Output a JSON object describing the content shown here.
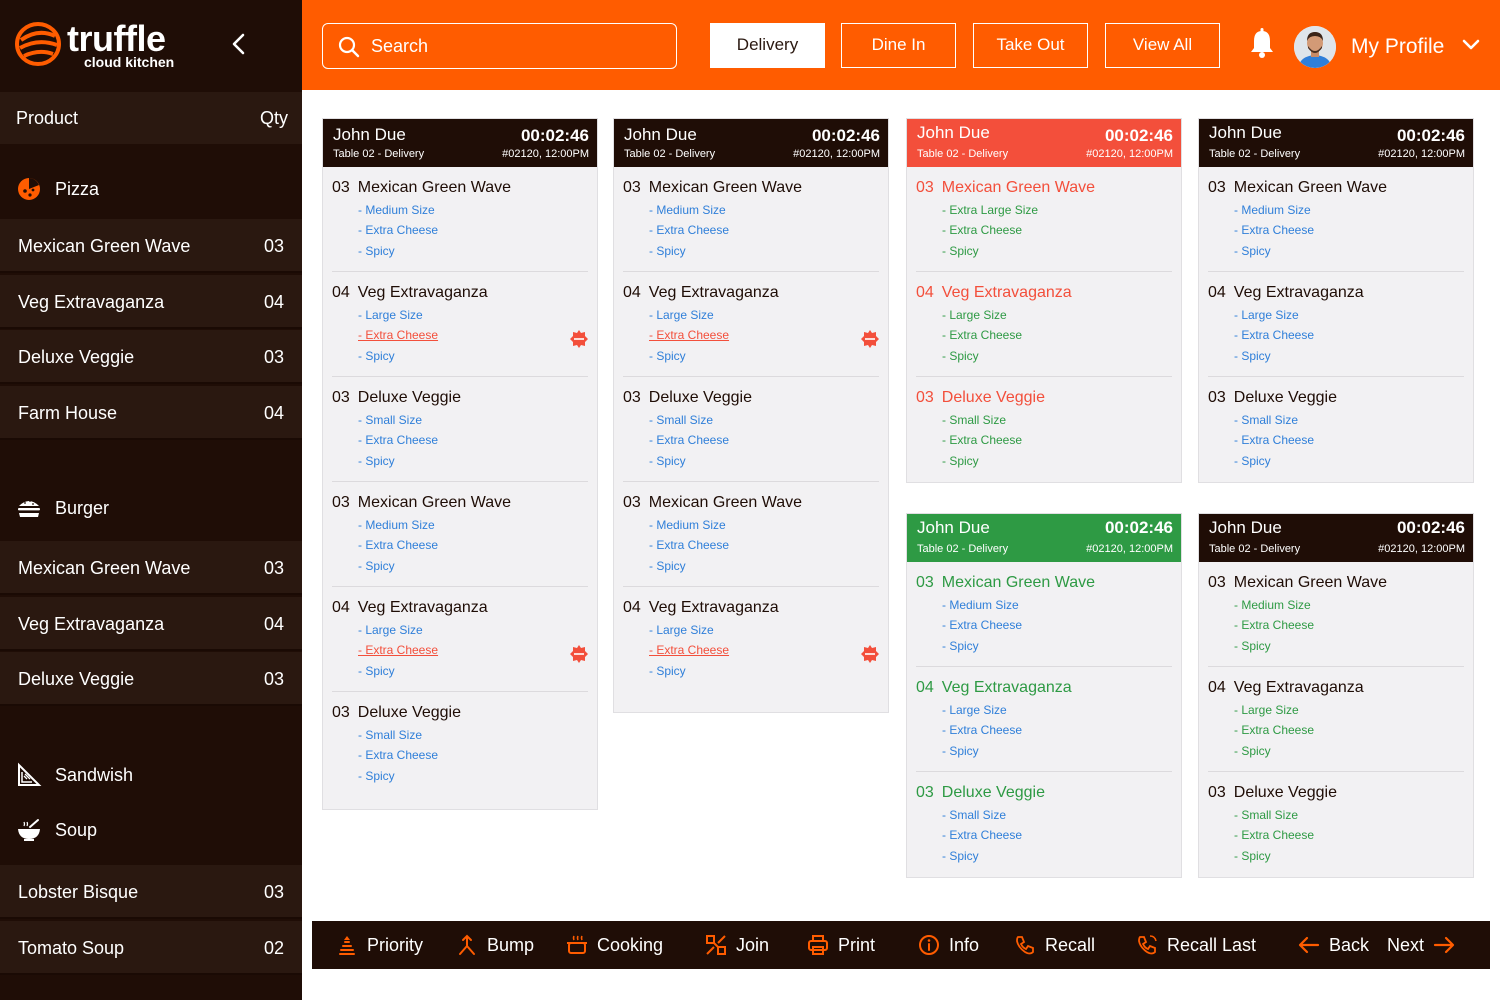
{
  "brand": {
    "name": "truffle",
    "tagline": "cloud kitchen"
  },
  "sidebar": {
    "header": {
      "product": "Product",
      "qty": "Qty"
    },
    "categories": [
      {
        "label": "Pizza",
        "icon": "pizza-icon",
        "items": [
          {
            "name": "Mexican Green Wave",
            "qty": "03"
          },
          {
            "name": "Veg Extravaganza",
            "qty": "04"
          },
          {
            "name": "Deluxe Veggie",
            "qty": "03"
          },
          {
            "name": "Farm House",
            "qty": "04"
          }
        ]
      },
      {
        "label": "Burger",
        "icon": "burger-icon",
        "items": [
          {
            "name": "Mexican Green Wave",
            "qty": "03"
          },
          {
            "name": "Veg Extravaganza",
            "qty": "04"
          },
          {
            "name": "Deluxe Veggie",
            "qty": "03"
          }
        ]
      },
      {
        "label": "Sandwish",
        "icon": "sandwich-icon",
        "items": []
      },
      {
        "label": "Soup",
        "icon": "soup-icon",
        "items": [
          {
            "name": "Lobster Bisque",
            "qty": "03"
          },
          {
            "name": "Tomato Soup",
            "qty": "02"
          }
        ]
      }
    ]
  },
  "header": {
    "search_placeholder": "Search",
    "filters": [
      "Delivery",
      "Dine In",
      "Take Out",
      "View All"
    ],
    "active_filter": "Delivery",
    "profile_name": "My Profile"
  },
  "colors": {
    "accent": "#ff5c00",
    "dark": "#1f0d06",
    "alert": "#f34f3b",
    "ready": "#2e9a44",
    "link": "#2f7fd9"
  },
  "orders": [
    {
      "customer": "John Due",
      "timer": "00:02:46",
      "table": "Table 02 - Delivery",
      "meta": "#02120,  12:00PM",
      "status": "default",
      "items": [
        {
          "qty": "03",
          "name": "Mexican Green Wave",
          "mods": [
            "- Medium Size",
            "- Extra Cheese",
            "- Spicy"
          ]
        },
        {
          "qty": "04",
          "name": "Veg Extravaganza",
          "mods": [
            "- Large Size",
            "- Extra Cheese",
            "- Spicy"
          ],
          "new": true
        },
        {
          "qty": "03",
          "name": "Deluxe Veggie",
          "mods": [
            "- Small Size",
            "- Extra Cheese",
            "- Spicy"
          ]
        },
        {
          "qty": "03",
          "name": "Mexican Green Wave",
          "mods": [
            "- Medium Size",
            "- Extra Cheese",
            "- Spicy"
          ]
        },
        {
          "qty": "04",
          "name": "Veg Extravaganza",
          "mods": [
            "- Large Size",
            "- Extra Cheese",
            "- Spicy"
          ],
          "new": true
        },
        {
          "qty": "03",
          "name": "Deluxe Veggie",
          "mods": [
            "- Small Size",
            "- Extra Cheese",
            "- Spicy"
          ]
        }
      ]
    },
    {
      "customer": "John Due",
      "timer": "00:02:46",
      "table": "Table 02 - Delivery",
      "meta": "#02120,  12:00PM",
      "status": "default",
      "items": [
        {
          "qty": "03",
          "name": "Mexican Green Wave",
          "mods": [
            "- Medium Size",
            "- Extra Cheese",
            "- Spicy"
          ]
        },
        {
          "qty": "04",
          "name": "Veg Extravaganza",
          "mods": [
            "- Large Size",
            "- Extra Cheese",
            "- Spicy"
          ],
          "new": true
        },
        {
          "qty": "03",
          "name": "Deluxe Veggie",
          "mods": [
            "- Small Size",
            "- Extra Cheese",
            "- Spicy"
          ]
        },
        {
          "qty": "03",
          "name": "Mexican Green Wave",
          "mods": [
            "- Medium Size",
            "- Extra Cheese",
            "- Spicy"
          ]
        },
        {
          "qty": "04",
          "name": "Veg Extravaganza",
          "mods": [
            "- Large Size",
            "- Extra Cheese",
            "- Spicy"
          ],
          "new": true
        }
      ]
    },
    {
      "customer": "John Due",
      "timer": "00:02:46",
      "table": "Table 02 - Delivery",
      "meta": "#02120,  12:00PM",
      "status": "overdue",
      "items": [
        {
          "qty": "03",
          "name": "Mexican Green Wave",
          "mods": [
            "- Extra Large Size",
            "- Extra Cheese",
            "- Spicy"
          ]
        },
        {
          "qty": "04",
          "name": "Veg Extravaganza",
          "mods": [
            "- Large Size",
            "- Extra Cheese",
            "- Spicy"
          ]
        },
        {
          "qty": "03",
          "name": "Deluxe Veggie",
          "mods": [
            "- Small Size",
            "- Extra Cheese",
            "- Spicy"
          ]
        }
      ]
    },
    {
      "customer": "John Due",
      "timer": "00:02:46",
      "table": "Table 02 - Delivery",
      "meta": "#02120,  12:00PM",
      "status": "default",
      "items": [
        {
          "qty": "03",
          "name": "Mexican Green Wave",
          "mods": [
            "- Medium Size",
            "- Extra Cheese",
            "- Spicy"
          ]
        },
        {
          "qty": "04",
          "name": "Veg Extravaganza",
          "mods": [
            "- Large Size",
            "- Extra Cheese",
            "- Spicy"
          ]
        },
        {
          "qty": "03",
          "name": "Deluxe Veggie",
          "mods": [
            "- Small Size",
            "- Extra Cheese",
            "- Spicy"
          ]
        }
      ]
    },
    {
      "customer": "John Due",
      "timer": "00:02:46",
      "table": "Table 02 - Delivery",
      "meta": "#02120,  12:00PM",
      "status": "ready",
      "items": [
        {
          "qty": "03",
          "name": "Mexican Green Wave",
          "mods": [
            "- Medium Size",
            "- Extra Cheese",
            "- Spicy"
          ]
        },
        {
          "qty": "04",
          "name": "Veg Extravaganza",
          "mods": [
            "- Large Size",
            "- Extra Cheese",
            "- Spicy"
          ]
        },
        {
          "qty": "03",
          "name": "Deluxe Veggie",
          "mods": [
            "- Small Size",
            "- Extra Cheese",
            "- Spicy"
          ]
        }
      ]
    },
    {
      "customer": "John Due",
      "timer": "00:02:46",
      "table": "Table 02 - Delivery",
      "meta": "#02120,  12:00PM",
      "status": "partial",
      "items": [
        {
          "qty": "03",
          "name": "Mexican Green Wave",
          "mods": [
            "- Medium Size",
            "- Extra Cheese",
            "- Spicy"
          ]
        },
        {
          "qty": "04",
          "name": "Veg Extravaganza",
          "mods": [
            "- Large Size",
            "- Extra Cheese",
            "- Spicy"
          ]
        },
        {
          "qty": "03",
          "name": "Deluxe Veggie",
          "mods": [
            "- Small Size",
            "- Extra Cheese",
            "- Spicy"
          ]
        }
      ]
    }
  ],
  "actions": [
    {
      "label": "Priority",
      "icon": "priority-icon"
    },
    {
      "label": "Bump",
      "icon": "bump-icon"
    },
    {
      "label": "Cooking",
      "icon": "cooking-icon"
    },
    {
      "label": "Join",
      "icon": "join-icon"
    },
    {
      "label": "Print",
      "icon": "print-icon"
    },
    {
      "label": "Info",
      "icon": "info-icon"
    },
    {
      "label": "Recall",
      "icon": "recall-icon"
    },
    {
      "label": "Recall Last",
      "icon": "recall-last-icon"
    },
    {
      "label": "Back",
      "icon": "arrow-left-icon"
    },
    {
      "label": "Next",
      "icon": "arrow-right-icon"
    }
  ]
}
